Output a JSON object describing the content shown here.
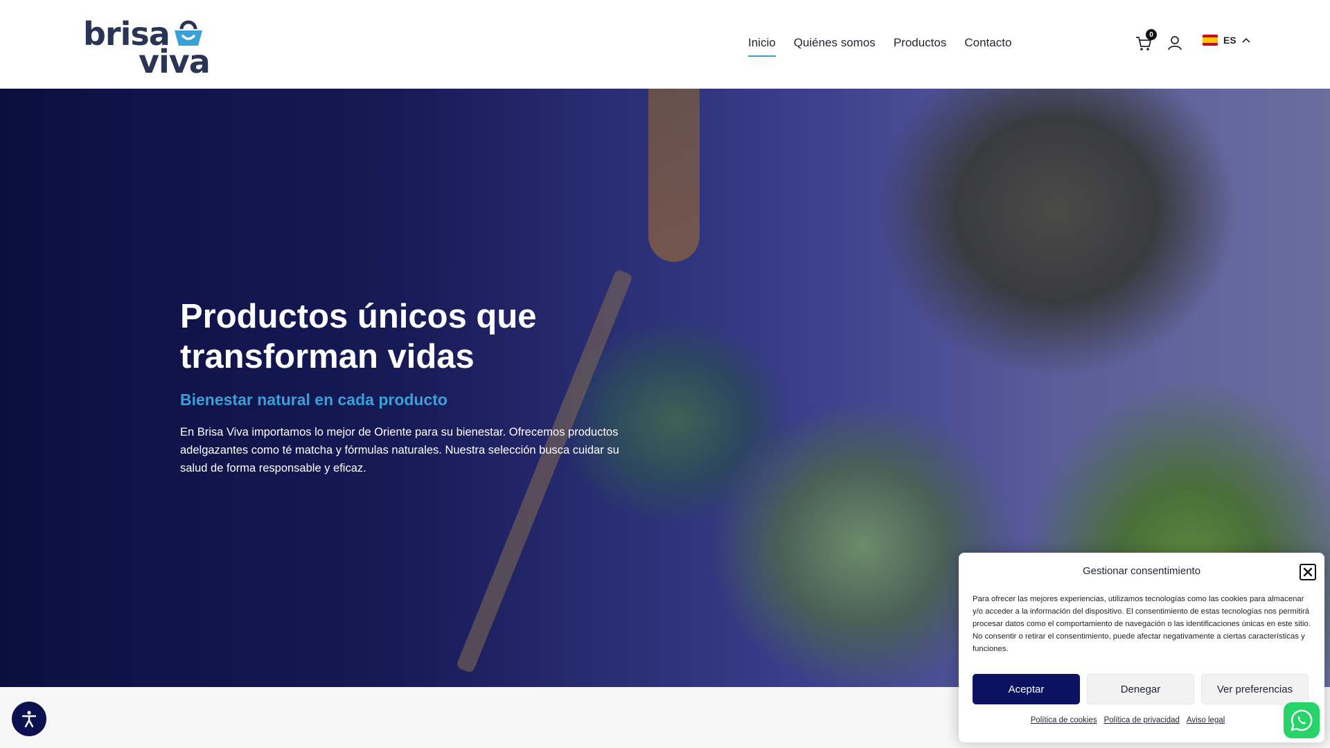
{
  "header": {
    "logo": {
      "line1": "brisa",
      "line2": "viva"
    },
    "nav": [
      {
        "label": "Inicio",
        "active": true
      },
      {
        "label": "Quiénes somos",
        "active": false
      },
      {
        "label": "Productos",
        "active": false
      },
      {
        "label": "Contacto",
        "active": false
      }
    ],
    "cart_count": "0",
    "language": "ES"
  },
  "hero": {
    "title": "Productos únicos que transforman vidas",
    "subtitle": "Bienestar natural en cada producto",
    "text": "En Brisa Viva importamos lo mejor de Oriente para su bienestar. Ofrecemos productos adelgazantes como té matcha y fórmulas naturales. Nuestra selección busca cuidar su salud de forma responsable y eficaz."
  },
  "consent": {
    "title": "Gestionar consentimiento",
    "body": "Para ofrecer las mejores experiencias, utilizamos tecnologías como las cookies para almacenar y/o acceder a la información del dispositivo. El consentimiento de estas tecnologías nos permitirá procesar datos como el comportamiento de navegación o las identificaciones únicas en este sitio. No consentir o retirar el consentimiento, puede afectar negativamente a ciertas características y funciones.",
    "accept_label": "Aceptar",
    "deny_label": "Denegar",
    "preferences_label": "Ver preferencias",
    "links": [
      "Política de cookies",
      "Política de privacidad",
      "Aviso legal"
    ]
  },
  "colors": {
    "brand_navy": "#0c1160",
    "accent_blue": "#3aa0d8",
    "whatsapp_green": "#25d366"
  }
}
